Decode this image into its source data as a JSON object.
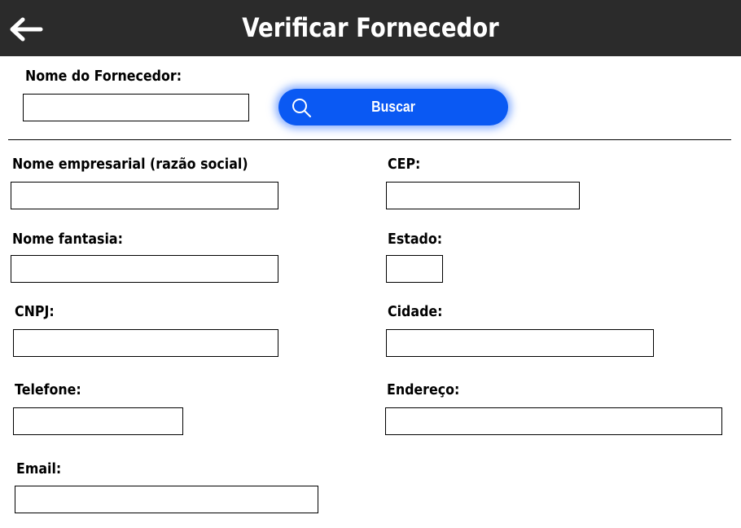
{
  "header": {
    "title": "Verificar Fornecedor",
    "background": "#2b2b2b"
  },
  "search": {
    "label": "Nome do Fornecedor:",
    "value": "",
    "button_label": "Buscar",
    "button_color": "#0a59f3",
    "icon": "search-icon"
  },
  "form": {
    "razao_social": {
      "label": "Nome empresarial (razão social)",
      "value": ""
    },
    "nome_fantasia": {
      "label": "Nome fantasia:",
      "value": ""
    },
    "cnpj": {
      "label": "CNPJ:",
      "value": ""
    },
    "telefone": {
      "label": "Telefone:",
      "value": ""
    },
    "email": {
      "label": "Email:",
      "value": ""
    },
    "cep": {
      "label": "CEP:",
      "value": ""
    },
    "estado": {
      "label": "Estado:",
      "value": ""
    },
    "cidade": {
      "label": "Cidade:",
      "value": ""
    },
    "endereco": {
      "label": "Endereço:",
      "value": ""
    }
  }
}
